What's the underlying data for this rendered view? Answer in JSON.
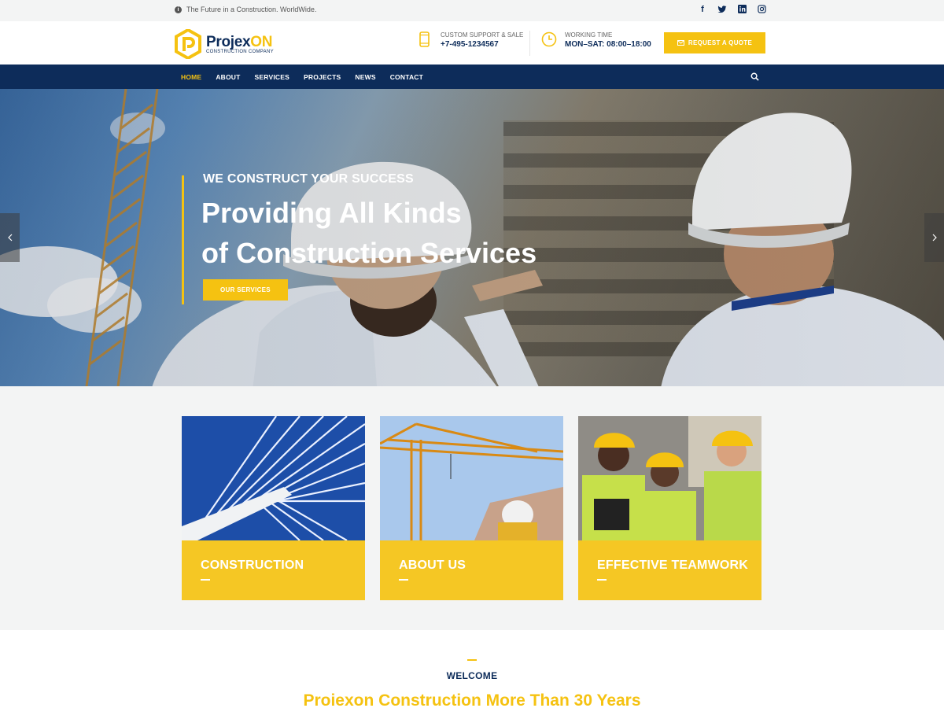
{
  "topbar": {
    "tagline": "The Future in a Construction. WorldWide.",
    "social": [
      "facebook-icon",
      "twitter-icon",
      "linkedin-icon",
      "instagram-icon"
    ]
  },
  "header": {
    "logo_name": "Projex",
    "logo_name_accent": "ON",
    "logo_sub": "CONSTRUCTION COMPANY",
    "support_label": "CUSTOM SUPPORT & SALE",
    "support_value": "+7-495-1234567",
    "hours_label": "WORKING TIME",
    "hours_value": "MON–SAT: 08:00–18:00",
    "quote_button": "REQUEST A QUOTE"
  },
  "nav": {
    "items": [
      "HOME",
      "ABOUT",
      "SERVICES",
      "PROJECTS",
      "NEWS",
      "CONTACT"
    ],
    "active": "HOME"
  },
  "hero": {
    "subtitle": "WE CONSTRUCT YOUR SUCCESS",
    "title_line1": "Providing All Kinds",
    "title_line2": "of Construction Services",
    "button": "OUR SERVICES"
  },
  "cards": [
    {
      "title": "CONSTRUCTION"
    },
    {
      "title": "ABOUT US"
    },
    {
      "title": "EFFECTIVE TEAMWORK"
    }
  ],
  "welcome": {
    "label": "WELCOME",
    "heading": "Proiexon Construction More Than 30 Years"
  },
  "colors": {
    "accent": "#f5c211",
    "navy": "#0d2c5a"
  }
}
